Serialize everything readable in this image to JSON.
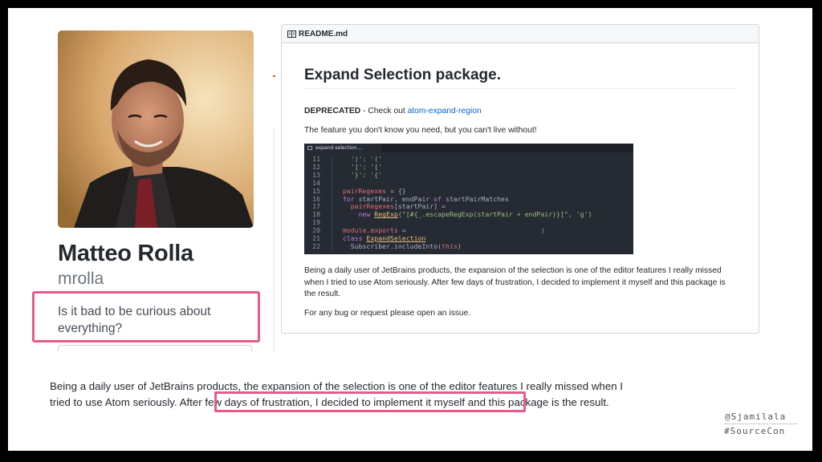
{
  "profile": {
    "name": "Matteo Rolla",
    "username": "mrolla",
    "bio": "Is it bad to be curious about everything?"
  },
  "readme": {
    "filename": "README.md",
    "title": "Expand Selection package.",
    "deprecated_label": "DEPRECATED",
    "deprecated_text": " - Check out ",
    "deprecated_link": "atom-expand-region",
    "tagline": "The feature you don't know you need, but you can't live without!",
    "description": "Being a daily user of JetBrains products, the expansion of the selection is one of the editor features I really missed when I tried to use Atom seriously. After few days of frustration, I decided to implement it myself and this package is the result.",
    "issue_note": "For any bug or request please open an issue."
  },
  "code_screenshot": {
    "tab_label": "expand-selection....",
    "lines": [
      {
        "n": "11",
        "segments": [
          {
            "t": "    ')': '('",
            "c": "str"
          }
        ]
      },
      {
        "n": "12",
        "segments": [
          {
            "t": "    ']': '['",
            "c": "str"
          }
        ]
      },
      {
        "n": "13",
        "segments": [
          {
            "t": "    '}': '{'",
            "c": "str"
          }
        ]
      },
      {
        "n": "14",
        "segments": []
      },
      {
        "n": "15",
        "segments": [
          {
            "t": "  pairRegexes",
            "c": "var"
          },
          {
            "t": " = {}",
            "c": "plain"
          }
        ]
      },
      {
        "n": "16",
        "segments": [
          {
            "t": "  for ",
            "c": "kw"
          },
          {
            "t": "startPair, endPair ",
            "c": "plain"
          },
          {
            "t": "of ",
            "c": "kw"
          },
          {
            "t": "startPairMatches",
            "c": "plain"
          }
        ]
      },
      {
        "n": "17",
        "segments": [
          {
            "t": "    pairRegexes",
            "c": "var"
          },
          {
            "t": "[startPair] =",
            "c": "plain"
          }
        ]
      },
      {
        "n": "18",
        "segments": [
          {
            "t": "      new ",
            "c": "kw"
          },
          {
            "t": "RegExp",
            "c": "cls"
          },
          {
            "t": "(\"[#{_.escapeRegExp(startPair + endPair)}]\", 'g')",
            "c": "str"
          }
        ]
      },
      {
        "n": "19",
        "segments": []
      },
      {
        "n": "20",
        "segments": [
          {
            "t": "  module.exports",
            "c": "var"
          },
          {
            "t": " =",
            "c": "plain"
          }
        ]
      },
      {
        "n": "21",
        "segments": [
          {
            "t": "  class ",
            "c": "kw"
          },
          {
            "t": "ExpandSelection",
            "c": "cls"
          }
        ]
      },
      {
        "n": "22",
        "segments": [
          {
            "t": "    Subscriber.includeInto(",
            "c": "plain"
          },
          {
            "t": "this",
            "c": "var"
          },
          {
            "t": ")",
            "c": "plain"
          }
        ]
      }
    ]
  },
  "bottom": {
    "text_before": "Being a daily user of JetBrains products, the expansion of the selection is one of the editor features I really missed when I tried to use Atom seriously. ",
    "text_highlighted": "After few days of frustration, I decided to implement it myself",
    "text_after": " and this package is the result."
  },
  "watermark": {
    "handle": "@Sjamilala",
    "hashtag": "#SourceCon"
  },
  "colors": {
    "highlight_border": "#e85a8b",
    "link": "#0366d6",
    "code_bg": "#262a33"
  }
}
